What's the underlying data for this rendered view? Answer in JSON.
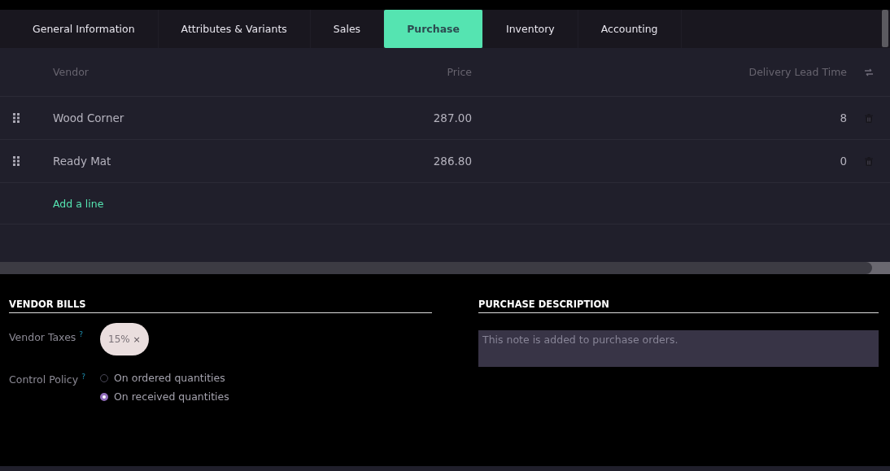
{
  "tabs": [
    {
      "label": "General Information",
      "selected": false
    },
    {
      "label": "Attributes & Variants",
      "selected": false
    },
    {
      "label": "Sales",
      "selected": false
    },
    {
      "label": "Purchase",
      "selected": true
    },
    {
      "label": "Inventory",
      "selected": false
    },
    {
      "label": "Accounting",
      "selected": false
    }
  ],
  "table": {
    "columns": [
      "Vendor",
      "Price",
      "Delivery Lead Time"
    ],
    "rows": [
      {
        "vendor": "Wood Corner",
        "price": "287.00",
        "lead_time": "8"
      },
      {
        "vendor": "Ready Mat",
        "price": "286.80",
        "lead_time": "0"
      }
    ],
    "add_line": "Add a line"
  },
  "vendor_bills": {
    "title": "VENDOR BILLS",
    "taxes": {
      "label": "Vendor Taxes",
      "help": "?",
      "tags": [
        {
          "label": "15%",
          "remove": "×"
        }
      ]
    },
    "control_policy": {
      "label": "Control Policy",
      "help": "?",
      "options": [
        {
          "label": "On ordered quantities",
          "selected": false
        },
        {
          "label": "On received quantities",
          "selected": true
        }
      ]
    }
  },
  "purchase_description": {
    "title": "PURCHASE DESCRIPTION",
    "placeholder": "This note is added to purchase orders."
  }
}
